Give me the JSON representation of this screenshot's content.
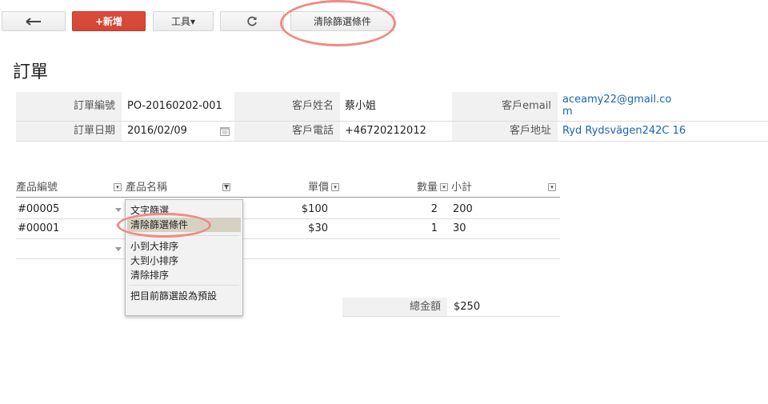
{
  "toolbar": {
    "back_icon": "arrow-left-icon",
    "new_label": "+新增",
    "tools_label": "工具▾",
    "refresh_icon": "refresh-icon",
    "clear_filter_label": "清除篩選條件"
  },
  "page": {
    "title": "訂單"
  },
  "form": {
    "order_no_label": "訂單編號",
    "order_no_value": "PO-20160202-001",
    "customer_name_label": "客戶姓名",
    "customer_name_value": "蔡小姐",
    "email_label": "客戶email",
    "email_value_line1": "aceamy22@gmail.co",
    "email_value_line2": "m",
    "order_date_label": "訂單日期",
    "order_date_value": "2016/02/09",
    "calendar_icon": "calendar-icon",
    "phone_label": "客戶電話",
    "phone_value": "+46720212012",
    "address_label": "客戶地址",
    "address_value": "Ryd Rydsvägen242C 16"
  },
  "table": {
    "columns": [
      "產品編號",
      "產品名稱",
      "單價",
      "數量",
      "小計"
    ],
    "rows": [
      {
        "product_no": "#00005",
        "price": "$100",
        "qty": "2",
        "subtotal": "200"
      },
      {
        "product_no": "#00001",
        "price": "$30",
        "qty": "1",
        "subtotal": "30"
      }
    ],
    "total_label": "總金額",
    "total_value": "$250"
  },
  "filter_menu": {
    "items": [
      "文字篩選",
      "清除篩選條件",
      "小到大排序",
      "大到小排序",
      "清除排序",
      "把目前篩選設為預設"
    ],
    "highlighted_index": 1
  },
  "colors": {
    "primary_button": "#dd4b39",
    "annotation": "#f08a85",
    "link": "#1a64b5"
  }
}
